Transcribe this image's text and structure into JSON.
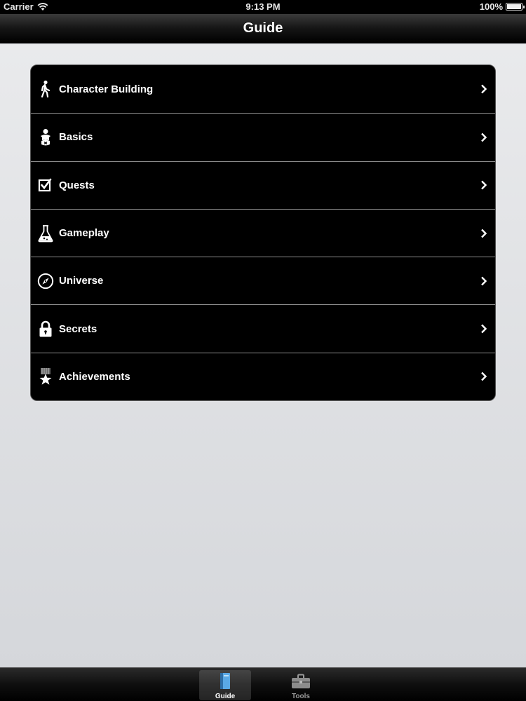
{
  "status_bar": {
    "carrier": "Carrier",
    "time": "9:13 PM",
    "battery": "100%"
  },
  "nav": {
    "title": "Guide"
  },
  "menu": {
    "items": [
      {
        "label": "Character Building",
        "icon": "walking-person-icon"
      },
      {
        "label": "Basics",
        "icon": "baby-icon"
      },
      {
        "label": "Quests",
        "icon": "checkbox-icon"
      },
      {
        "label": "Gameplay",
        "icon": "flask-icon"
      },
      {
        "label": "Universe",
        "icon": "compass-icon"
      },
      {
        "label": "Secrets",
        "icon": "lock-icon"
      },
      {
        "label": "Achievements",
        "icon": "medal-star-icon"
      }
    ]
  },
  "tabs": {
    "items": [
      {
        "label": "Guide",
        "icon": "book-icon",
        "selected": true
      },
      {
        "label": "Tools",
        "icon": "toolbox-icon",
        "selected": false
      }
    ]
  },
  "colors": {
    "nav_bg": "#000000",
    "menu_bg": "#000000",
    "separator": "#8d8d8d",
    "content_bg": "#dcdee2",
    "guide_icon_accent": "#5aa9e6"
  }
}
